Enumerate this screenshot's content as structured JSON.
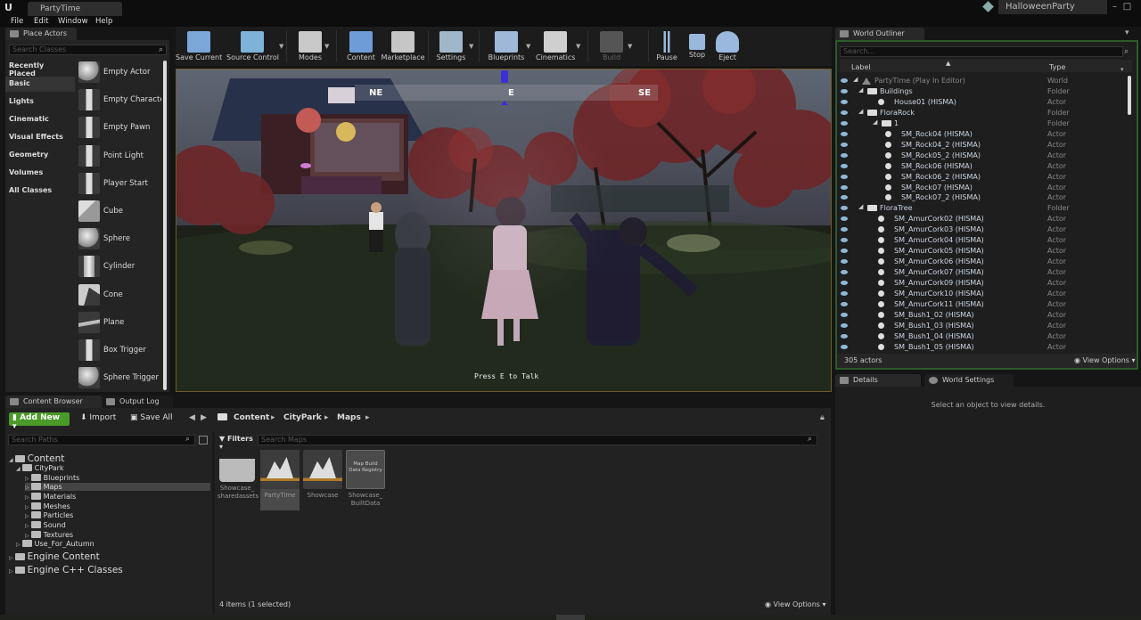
{
  "window": {
    "doc_tab": "PartyTime",
    "project": "HalloweenParty"
  },
  "menu": [
    "File",
    "Edit",
    "Window",
    "Help"
  ],
  "place_actors": {
    "tab": "Place Actors",
    "search_placeholder": "Search Classes",
    "categories": [
      "Recently Placed",
      "Basic",
      "Lights",
      "Cinematic",
      "Visual Effects",
      "Geometry",
      "Volumes",
      "All Classes"
    ],
    "selected_category": "Basic",
    "actors": [
      "Empty Actor",
      "Empty Characte",
      "Empty Pawn",
      "Point Light",
      "Player Start",
      "Cube",
      "Sphere",
      "Cylinder",
      "Cone",
      "Plane",
      "Box Trigger",
      "Sphere Trigger"
    ]
  },
  "toolbar": {
    "buttons": [
      "Save Current",
      "Source Control",
      "Modes",
      "Content",
      "Marketplace",
      "Settings",
      "Blueprints",
      "Cinematics",
      "Build",
      "Pause",
      "Stop",
      "Eject"
    ]
  },
  "viewport": {
    "compass": [
      "NE",
      "E",
      "SE"
    ],
    "prompt": "Press E to Talk"
  },
  "world_outliner": {
    "tab": "World Outliner",
    "search_placeholder": "Search...",
    "col_label": "Label",
    "col_type": "Type",
    "rows": [
      {
        "label": "PartyTime (Play In Editor)",
        "type": "World",
        "indent": 0,
        "kind": "world"
      },
      {
        "label": "Buildings",
        "type": "Folder",
        "indent": 1,
        "kind": "folder"
      },
      {
        "label": "House01 (HISMA)",
        "type": "Actor",
        "indent": 2,
        "kind": "actor"
      },
      {
        "label": "FloraRock",
        "type": "Folder",
        "indent": 1,
        "kind": "folder"
      },
      {
        "label": "1",
        "type": "Folder",
        "indent": 2,
        "kind": "folder"
      },
      {
        "label": "SM_Rock04 (HISMA)",
        "type": "Actor",
        "indent": 3,
        "kind": "actor"
      },
      {
        "label": "SM_Rock04_2 (HISMA)",
        "type": "Actor",
        "indent": 3,
        "kind": "actor"
      },
      {
        "label": "SM_Rock05_2 (HISMA)",
        "type": "Actor",
        "indent": 3,
        "kind": "actor"
      },
      {
        "label": "SM_Rock06 (HISMA)",
        "type": "Actor",
        "indent": 3,
        "kind": "actor"
      },
      {
        "label": "SM_Rock06_2 (HISMA)",
        "type": "Actor",
        "indent": 3,
        "kind": "actor"
      },
      {
        "label": "SM_Rock07 (HISMA)",
        "type": "Actor",
        "indent": 3,
        "kind": "actor"
      },
      {
        "label": "SM_Rock07_2 (HISMA)",
        "type": "Actor",
        "indent": 3,
        "kind": "actor"
      },
      {
        "label": "FloraTree",
        "type": "Folder",
        "indent": 1,
        "kind": "folder"
      },
      {
        "label": "SM_AmurCork02 (HISMA)",
        "type": "Actor",
        "indent": 2,
        "kind": "actor"
      },
      {
        "label": "SM_AmurCork03 (HISMA)",
        "type": "Actor",
        "indent": 2,
        "kind": "actor"
      },
      {
        "label": "SM_AmurCork04 (HISMA)",
        "type": "Actor",
        "indent": 2,
        "kind": "actor"
      },
      {
        "label": "SM_AmurCork05 (HISMA)",
        "type": "Actor",
        "indent": 2,
        "kind": "actor"
      },
      {
        "label": "SM_AmurCork06 (HISMA)",
        "type": "Actor",
        "indent": 2,
        "kind": "actor"
      },
      {
        "label": "SM_AmurCork07 (HISMA)",
        "type": "Actor",
        "indent": 2,
        "kind": "actor"
      },
      {
        "label": "SM_AmurCork09 (HISMA)",
        "type": "Actor",
        "indent": 2,
        "kind": "actor"
      },
      {
        "label": "SM_AmurCork10 (HISMA)",
        "type": "Actor",
        "indent": 2,
        "kind": "actor"
      },
      {
        "label": "SM_AmurCork11 (HISMA)",
        "type": "Actor",
        "indent": 2,
        "kind": "actor"
      },
      {
        "label": "SM_Bush1_02 (HISMA)",
        "type": "Actor",
        "indent": 2,
        "kind": "actor"
      },
      {
        "label": "SM_Bush1_03 (HISMA)",
        "type": "Actor",
        "indent": 2,
        "kind": "actor"
      },
      {
        "label": "SM_Bush1_04 (HISMA)",
        "type": "Actor",
        "indent": 2,
        "kind": "actor"
      },
      {
        "label": "SM_Bush1_05 (HISMA)",
        "type": "Actor",
        "indent": 2,
        "kind": "actor"
      }
    ],
    "actor_count": "305 actors",
    "view_options": "View Options"
  },
  "details": {
    "tab": "Details",
    "tab2": "World Settings",
    "empty_msg": "Select an object to view details."
  },
  "content_browser": {
    "tab": "Content Browser",
    "tab2": "Output Log",
    "add_new": "Add New",
    "import": "Import",
    "save_all": "Save All",
    "breadcrumb": [
      "Content",
      "CityPark",
      "Maps"
    ],
    "search_paths_placeholder": "Search Paths",
    "filters": "Filters",
    "search_placeholder": "Search Maps",
    "tree": [
      {
        "label": "Content",
        "indent": 0,
        "big": true
      },
      {
        "label": "CityPark",
        "indent": 1
      },
      {
        "label": "Blueprints",
        "indent": 2
      },
      {
        "label": "Maps",
        "indent": 2,
        "selected": true
      },
      {
        "label": "Materials",
        "indent": 2
      },
      {
        "label": "Meshes",
        "indent": 2
      },
      {
        "label": "Particles",
        "indent": 2
      },
      {
        "label": "Sound",
        "indent": 2
      },
      {
        "label": "Textures",
        "indent": 2
      },
      {
        "label": "Use_For_Autumn",
        "indent": 1
      },
      {
        "label": "Engine Content",
        "indent": 0,
        "big": true
      },
      {
        "label": "Engine C++ Classes",
        "indent": 0,
        "big": true
      }
    ],
    "assets": [
      {
        "name": "Showcase_ sharedassets",
        "kind": "folder"
      },
      {
        "name": "PartyTime",
        "kind": "map",
        "selected": true
      },
      {
        "name": "Showcase",
        "kind": "map"
      },
      {
        "name": "Showcase_ BuiltData",
        "kind": "registry",
        "thumb_text": "Map Build Data Registry"
      }
    ],
    "status": "4 items (1 selected)",
    "view_options": "View Options"
  },
  "colors": {
    "accent_green": "#4a9a2a",
    "outliner_border": "#2c5a2c",
    "viewport_border": "#6f5b2b",
    "map_thumb": "#b07a2a"
  }
}
